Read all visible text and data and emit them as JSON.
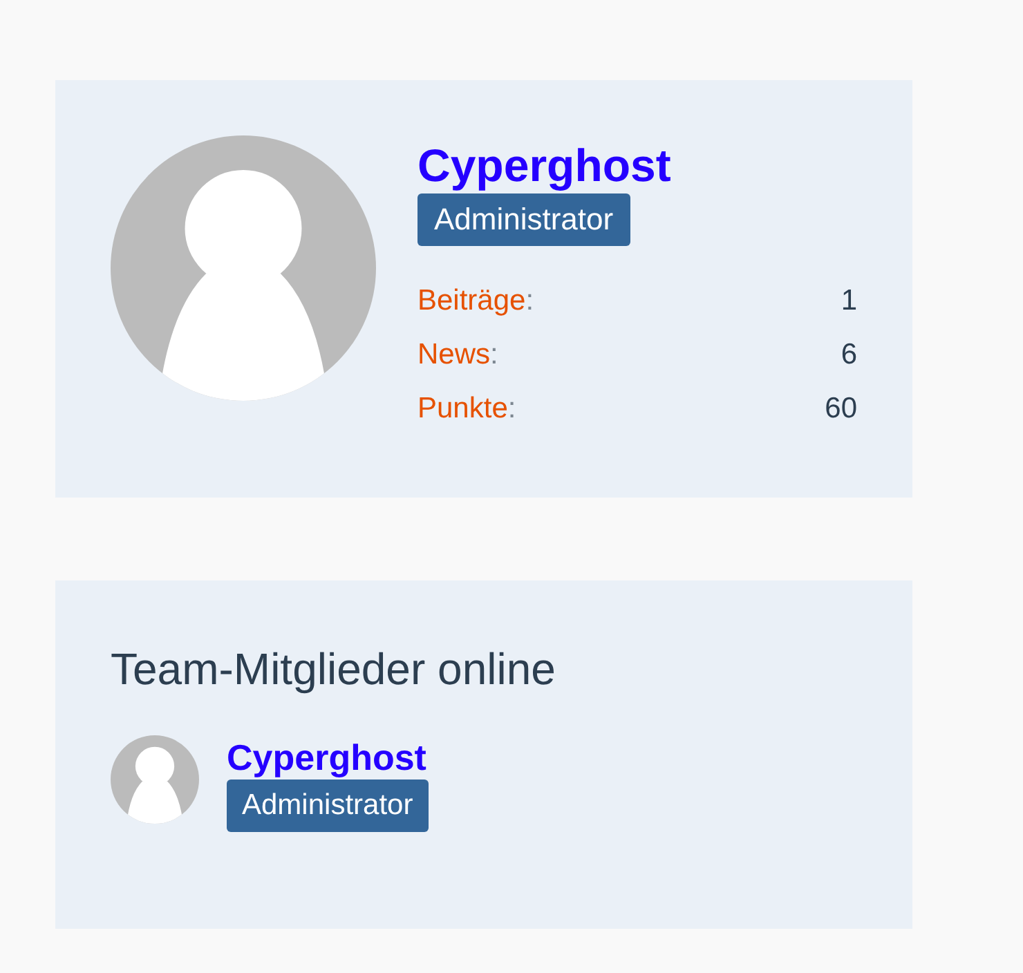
{
  "profile": {
    "name": "Cyperghost",
    "rank": "Administrator",
    "stats": [
      {
        "label": "Beiträge",
        "separator": ":",
        "value": "1"
      },
      {
        "label": "News",
        "separator": ":",
        "value": "6"
      },
      {
        "label": "Punkte",
        "separator": ":",
        "value": "60"
      }
    ]
  },
  "team_online": {
    "title": "Team-Mitglieder online",
    "members": [
      {
        "name": "Cyperghost",
        "rank": "Administrator"
      }
    ]
  }
}
